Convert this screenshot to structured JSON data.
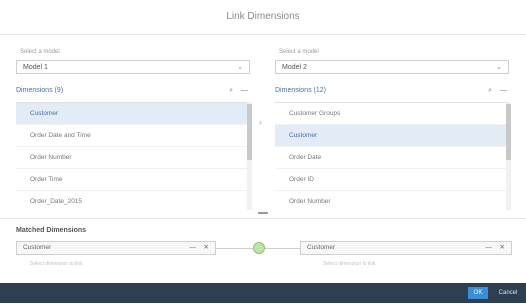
{
  "dialog": {
    "title": "Link Dimensions",
    "ok_label": "OK",
    "cancel_label": "Cancel"
  },
  "left": {
    "model_label": "Select a model",
    "model_value": "Model 1",
    "dim_header": "Dimensions (9)",
    "items": [
      "Customer",
      "Order Date and Time",
      "Order Number",
      "Order Time",
      "Order_Date_2015"
    ],
    "selected_index": 0
  },
  "right": {
    "model_label": "Select a model",
    "model_value": "Model 2",
    "dim_header": "Dimensions (12)",
    "items": [
      "Customer Groups",
      "Customer",
      "Order Date",
      "Order ID",
      "Order Number"
    ],
    "selected_index": 1
  },
  "matched": {
    "header": "Matched Dimensions",
    "left_value": "Customer",
    "right_value": "Customer",
    "left_hint": "Select dimension to link",
    "right_hint": "Select dimension to link"
  },
  "icons": {
    "search": "search-icon",
    "more": "more-icon",
    "chevron": "chevron-down-icon",
    "close": "close-icon",
    "link": "link-icon"
  }
}
